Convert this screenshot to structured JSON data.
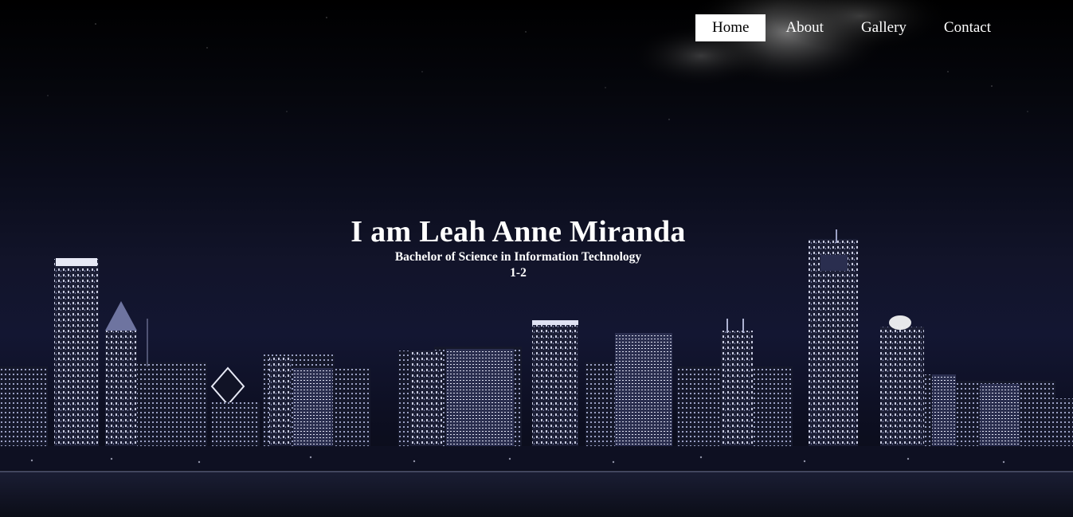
{
  "nav": {
    "items": [
      {
        "label": "Home",
        "active": true
      },
      {
        "label": "About",
        "active": false
      },
      {
        "label": "Gallery",
        "active": false
      },
      {
        "label": "Contact",
        "active": false
      }
    ]
  },
  "hero": {
    "heading": "I am Leah Anne Miranda",
    "degree": "Bachelor of Science in Information Technology",
    "section": "1-2"
  },
  "colors": {
    "nav_active_bg": "#ffffff",
    "nav_active_text": "#000000",
    "text": "#ffffff",
    "sky_top": "#000000",
    "sky_mid": "#12142a",
    "city_light": "#c8cbe0"
  },
  "background_image": "night-city-skyline"
}
